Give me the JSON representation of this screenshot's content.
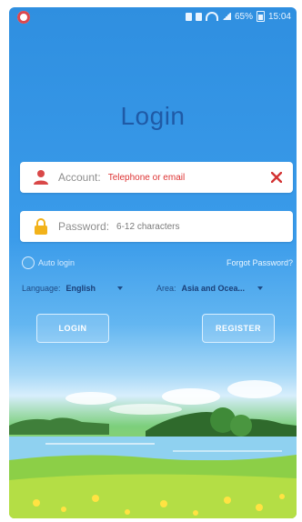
{
  "status_bar": {
    "battery": "65%",
    "time": "15:04"
  },
  "title": "Login",
  "account": {
    "label": "Account:",
    "placeholder": "Telephone or email"
  },
  "password": {
    "label": "Password:",
    "placeholder": "6-12 characters"
  },
  "auto_login": "Auto login",
  "forgot_password": "Forgot Password?",
  "language": {
    "label": "Language:",
    "value": "English"
  },
  "area": {
    "label": "Area:",
    "value": "Asia and Ocea..."
  },
  "buttons": {
    "login": "LOGIN",
    "register": "REGISTER"
  },
  "colors": {
    "accent": "#3a9bea",
    "title": "#1f5aa6",
    "error": "#d33333",
    "user_icon": "#d94848",
    "lock_icon": "#f2b21a"
  }
}
